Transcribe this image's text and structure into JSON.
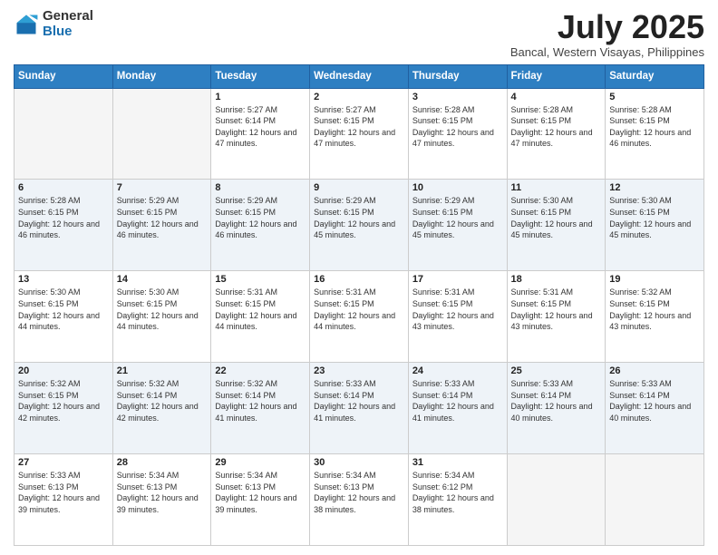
{
  "header": {
    "logo_general": "General",
    "logo_blue": "Blue",
    "month_title": "July 2025",
    "subtitle": "Bancal, Western Visayas, Philippines"
  },
  "days_of_week": [
    "Sunday",
    "Monday",
    "Tuesday",
    "Wednesday",
    "Thursday",
    "Friday",
    "Saturday"
  ],
  "weeks": [
    [
      {
        "day": "",
        "sunrise": "",
        "sunset": "",
        "daylight": ""
      },
      {
        "day": "",
        "sunrise": "",
        "sunset": "",
        "daylight": ""
      },
      {
        "day": "1",
        "sunrise": "Sunrise: 5:27 AM",
        "sunset": "Sunset: 6:14 PM",
        "daylight": "Daylight: 12 hours and 47 minutes."
      },
      {
        "day": "2",
        "sunrise": "Sunrise: 5:27 AM",
        "sunset": "Sunset: 6:15 PM",
        "daylight": "Daylight: 12 hours and 47 minutes."
      },
      {
        "day": "3",
        "sunrise": "Sunrise: 5:28 AM",
        "sunset": "Sunset: 6:15 PM",
        "daylight": "Daylight: 12 hours and 47 minutes."
      },
      {
        "day": "4",
        "sunrise": "Sunrise: 5:28 AM",
        "sunset": "Sunset: 6:15 PM",
        "daylight": "Daylight: 12 hours and 47 minutes."
      },
      {
        "day": "5",
        "sunrise": "Sunrise: 5:28 AM",
        "sunset": "Sunset: 6:15 PM",
        "daylight": "Daylight: 12 hours and 46 minutes."
      }
    ],
    [
      {
        "day": "6",
        "sunrise": "Sunrise: 5:28 AM",
        "sunset": "Sunset: 6:15 PM",
        "daylight": "Daylight: 12 hours and 46 minutes."
      },
      {
        "day": "7",
        "sunrise": "Sunrise: 5:29 AM",
        "sunset": "Sunset: 6:15 PM",
        "daylight": "Daylight: 12 hours and 46 minutes."
      },
      {
        "day": "8",
        "sunrise": "Sunrise: 5:29 AM",
        "sunset": "Sunset: 6:15 PM",
        "daylight": "Daylight: 12 hours and 46 minutes."
      },
      {
        "day": "9",
        "sunrise": "Sunrise: 5:29 AM",
        "sunset": "Sunset: 6:15 PM",
        "daylight": "Daylight: 12 hours and 45 minutes."
      },
      {
        "day": "10",
        "sunrise": "Sunrise: 5:29 AM",
        "sunset": "Sunset: 6:15 PM",
        "daylight": "Daylight: 12 hours and 45 minutes."
      },
      {
        "day": "11",
        "sunrise": "Sunrise: 5:30 AM",
        "sunset": "Sunset: 6:15 PM",
        "daylight": "Daylight: 12 hours and 45 minutes."
      },
      {
        "day": "12",
        "sunrise": "Sunrise: 5:30 AM",
        "sunset": "Sunset: 6:15 PM",
        "daylight": "Daylight: 12 hours and 45 minutes."
      }
    ],
    [
      {
        "day": "13",
        "sunrise": "Sunrise: 5:30 AM",
        "sunset": "Sunset: 6:15 PM",
        "daylight": "Daylight: 12 hours and 44 minutes."
      },
      {
        "day": "14",
        "sunrise": "Sunrise: 5:30 AM",
        "sunset": "Sunset: 6:15 PM",
        "daylight": "Daylight: 12 hours and 44 minutes."
      },
      {
        "day": "15",
        "sunrise": "Sunrise: 5:31 AM",
        "sunset": "Sunset: 6:15 PM",
        "daylight": "Daylight: 12 hours and 44 minutes."
      },
      {
        "day": "16",
        "sunrise": "Sunrise: 5:31 AM",
        "sunset": "Sunset: 6:15 PM",
        "daylight": "Daylight: 12 hours and 44 minutes."
      },
      {
        "day": "17",
        "sunrise": "Sunrise: 5:31 AM",
        "sunset": "Sunset: 6:15 PM",
        "daylight": "Daylight: 12 hours and 43 minutes."
      },
      {
        "day": "18",
        "sunrise": "Sunrise: 5:31 AM",
        "sunset": "Sunset: 6:15 PM",
        "daylight": "Daylight: 12 hours and 43 minutes."
      },
      {
        "day": "19",
        "sunrise": "Sunrise: 5:32 AM",
        "sunset": "Sunset: 6:15 PM",
        "daylight": "Daylight: 12 hours and 43 minutes."
      }
    ],
    [
      {
        "day": "20",
        "sunrise": "Sunrise: 5:32 AM",
        "sunset": "Sunset: 6:15 PM",
        "daylight": "Daylight: 12 hours and 42 minutes."
      },
      {
        "day": "21",
        "sunrise": "Sunrise: 5:32 AM",
        "sunset": "Sunset: 6:14 PM",
        "daylight": "Daylight: 12 hours and 42 minutes."
      },
      {
        "day": "22",
        "sunrise": "Sunrise: 5:32 AM",
        "sunset": "Sunset: 6:14 PM",
        "daylight": "Daylight: 12 hours and 41 minutes."
      },
      {
        "day": "23",
        "sunrise": "Sunrise: 5:33 AM",
        "sunset": "Sunset: 6:14 PM",
        "daylight": "Daylight: 12 hours and 41 minutes."
      },
      {
        "day": "24",
        "sunrise": "Sunrise: 5:33 AM",
        "sunset": "Sunset: 6:14 PM",
        "daylight": "Daylight: 12 hours and 41 minutes."
      },
      {
        "day": "25",
        "sunrise": "Sunrise: 5:33 AM",
        "sunset": "Sunset: 6:14 PM",
        "daylight": "Daylight: 12 hours and 40 minutes."
      },
      {
        "day": "26",
        "sunrise": "Sunrise: 5:33 AM",
        "sunset": "Sunset: 6:14 PM",
        "daylight": "Daylight: 12 hours and 40 minutes."
      }
    ],
    [
      {
        "day": "27",
        "sunrise": "Sunrise: 5:33 AM",
        "sunset": "Sunset: 6:13 PM",
        "daylight": "Daylight: 12 hours and 39 minutes."
      },
      {
        "day": "28",
        "sunrise": "Sunrise: 5:34 AM",
        "sunset": "Sunset: 6:13 PM",
        "daylight": "Daylight: 12 hours and 39 minutes."
      },
      {
        "day": "29",
        "sunrise": "Sunrise: 5:34 AM",
        "sunset": "Sunset: 6:13 PM",
        "daylight": "Daylight: 12 hours and 39 minutes."
      },
      {
        "day": "30",
        "sunrise": "Sunrise: 5:34 AM",
        "sunset": "Sunset: 6:13 PM",
        "daylight": "Daylight: 12 hours and 38 minutes."
      },
      {
        "day": "31",
        "sunrise": "Sunrise: 5:34 AM",
        "sunset": "Sunset: 6:12 PM",
        "daylight": "Daylight: 12 hours and 38 minutes."
      },
      {
        "day": "",
        "sunrise": "",
        "sunset": "",
        "daylight": ""
      },
      {
        "day": "",
        "sunrise": "",
        "sunset": "",
        "daylight": ""
      }
    ]
  ]
}
